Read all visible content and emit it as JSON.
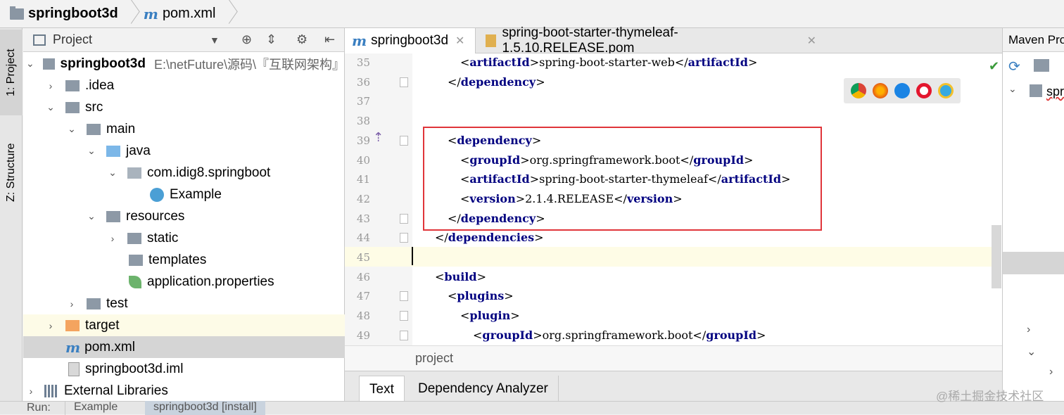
{
  "breadcrumb": {
    "project": "springboot3d",
    "file": "pom.xml"
  },
  "left_strip": {
    "tab_project": "1: Project",
    "tab_structure": "Z: Structure"
  },
  "project_panel": {
    "title": "Project",
    "tree": [
      {
        "label": "springboot3d",
        "extra": "E:\\netFuture\\源码\\『互联网架构』"
      },
      {
        "label": ".idea"
      },
      {
        "label": "src"
      },
      {
        "label": "main"
      },
      {
        "label": "java"
      },
      {
        "label": "com.idig8.springboot"
      },
      {
        "label": "Example"
      },
      {
        "label": "resources"
      },
      {
        "label": "static"
      },
      {
        "label": "templates"
      },
      {
        "label": "application.properties"
      },
      {
        "label": "test"
      },
      {
        "label": "target"
      },
      {
        "label": "pom.xml"
      },
      {
        "label": "springboot3d.iml"
      },
      {
        "label": "External Libraries"
      }
    ]
  },
  "editor": {
    "tabs": [
      {
        "label": "springboot3d"
      },
      {
        "label": "spring-boot-starter-thymeleaf-1.5.10.RELEASE.pom"
      }
    ],
    "lines": [
      {
        "num": "35",
        "pre": "",
        "parts": [
          "<",
          "artifactId",
          ">",
          "spring-boot-starter-web",
          "</",
          "artifactId",
          ">"
        ]
      },
      {
        "num": "36",
        "parts": [
          "</",
          "dependency",
          ">"
        ]
      },
      {
        "num": "37",
        "parts": []
      },
      {
        "num": "38",
        "parts": []
      },
      {
        "num": "39",
        "parts": [
          "<",
          "dependency",
          ">"
        ]
      },
      {
        "num": "40",
        "parts": [
          "<",
          "groupId",
          ">",
          "org.springframework.boot",
          "</",
          "groupId",
          ">"
        ]
      },
      {
        "num": "41",
        "parts": [
          "<",
          "artifactId",
          ">",
          "spring-boot-starter-thymeleaf",
          "</",
          "artifactId",
          ">"
        ]
      },
      {
        "num": "42",
        "parts": [
          "<",
          "version",
          ">",
          "2.1.4.RELEASE",
          "</",
          "version",
          ">"
        ]
      },
      {
        "num": "43",
        "parts": [
          "</",
          "dependency",
          ">"
        ]
      },
      {
        "num": "44",
        "parts": [
          "</",
          "dependencies",
          ">"
        ]
      },
      {
        "num": "45",
        "parts": []
      },
      {
        "num": "46",
        "parts": [
          "<",
          "build",
          ">"
        ]
      },
      {
        "num": "47",
        "parts": [
          "<",
          "plugins",
          ">"
        ]
      },
      {
        "num": "48",
        "parts": [
          "<",
          "plugin",
          ">"
        ]
      },
      {
        "num": "49",
        "parts": [
          "<",
          "groupId",
          ">",
          "org.springframework.boot",
          "</",
          "groupId",
          ">"
        ]
      }
    ],
    "breadcrumb": "project"
  },
  "bottom_tabs": {
    "text": "Text",
    "dependency_analyzer": "Dependency Analyzer"
  },
  "right_panel": {
    "title": "Maven Pro",
    "item": "spr"
  },
  "status_bar": {
    "run": "Run:",
    "example": "Example",
    "install": "springboot3d [install]"
  },
  "watermark": "@稀土掘金技术社区",
  "colors": {
    "tag": "#000080",
    "highlight_box": "#e0353a",
    "caret_line": "#fefce6"
  }
}
